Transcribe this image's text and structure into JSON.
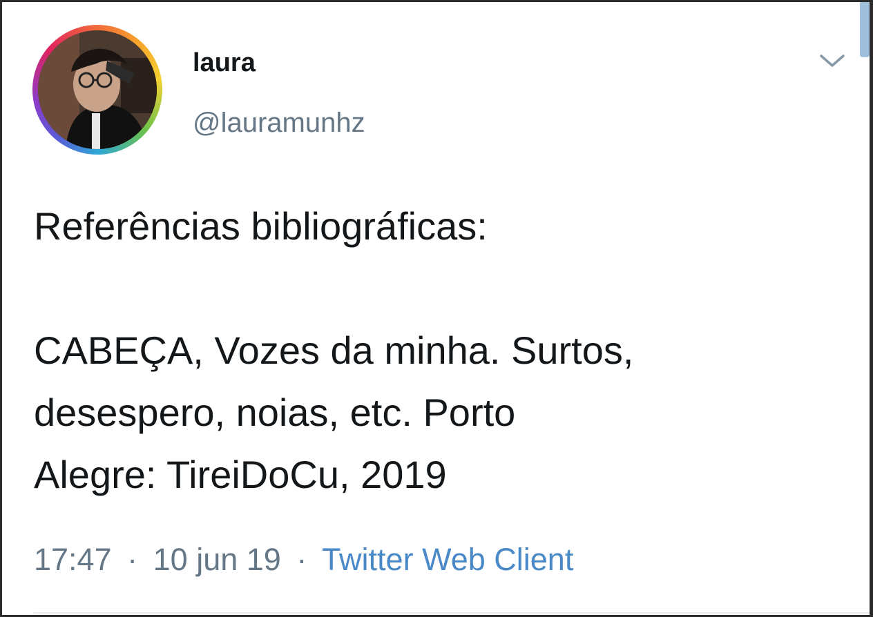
{
  "author": {
    "display_name": "laura",
    "handle": "@lauramunhz"
  },
  "tweet": {
    "heading": "Referências bibliográficas:",
    "body_lines": [
      "CABEÇA, Vozes da minha. Surtos,",
      "desespero, noias, etc. Porto",
      "Alegre: TireiDoCu, 2019"
    ]
  },
  "meta": {
    "time": "17:47",
    "date": "10 jun 19",
    "separator": "·",
    "source": "Twitter Web Client"
  },
  "icons": {
    "menu": "chevron-down-icon",
    "avatar": "avatar"
  },
  "colors": {
    "text": "#14171a",
    "secondary_text": "#657786",
    "source_link": "#4a89c8",
    "avatar_ring": "rainbow"
  }
}
